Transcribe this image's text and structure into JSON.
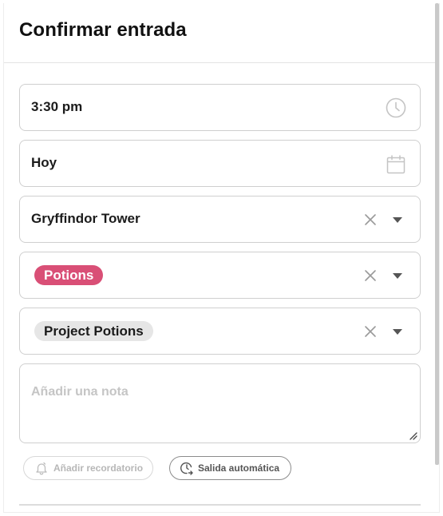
{
  "dialog": {
    "title": "Confirmar entrada"
  },
  "fields": {
    "time": {
      "value": "3:30 pm",
      "icon": "clock-icon"
    },
    "date": {
      "value": "Hoy",
      "icon": "calendar-icon"
    },
    "location": {
      "value": "Gryffindor Tower"
    },
    "activity": {
      "value": "Potions",
      "color": "#d94f76"
    },
    "project": {
      "value": "Project Potions"
    },
    "note": {
      "placeholder": "Añadir una nota"
    }
  },
  "actions": {
    "reminder_label": "Añadir recordatorio",
    "auto_exit_label": "Salida automática"
  },
  "colors": {
    "accent_pink": "#d94f76",
    "border": "#cfcfcf",
    "placeholder": "#c5c5c5"
  }
}
